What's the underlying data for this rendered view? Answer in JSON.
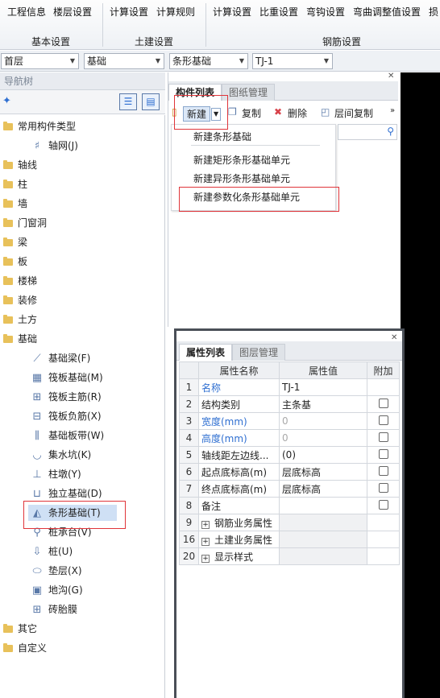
{
  "ribbon": {
    "items": [
      "工程信息",
      "楼层设置",
      "计算设置",
      "计算规则",
      "计算设置",
      "比重设置",
      "弯钩设置",
      "弯曲调整值设置",
      "损"
    ],
    "groups": [
      "基本设置",
      "土建设置",
      "钢筋设置"
    ]
  },
  "selectors": [
    "首层",
    "基础",
    "条形基础",
    "TJ-1"
  ],
  "nav": {
    "title": "导航树",
    "tree": [
      {
        "label": "常用构件类型",
        "type": "folder"
      },
      {
        "label": "轴网(J)",
        "type": "child",
        "icon": "grid-icon"
      },
      {
        "label": "轴线",
        "type": "folder"
      },
      {
        "label": "柱",
        "type": "folder"
      },
      {
        "label": "墙",
        "type": "folder"
      },
      {
        "label": "门窗洞",
        "type": "folder"
      },
      {
        "label": "梁",
        "type": "folder"
      },
      {
        "label": "板",
        "type": "folder"
      },
      {
        "label": "楼梯",
        "type": "folder"
      },
      {
        "label": "装修",
        "type": "folder"
      },
      {
        "label": "土方",
        "type": "folder"
      },
      {
        "label": "基础",
        "type": "folder"
      },
      {
        "label": "基础梁(F)",
        "type": "child",
        "icon": "foundation-beam-icon"
      },
      {
        "label": "筏板基础(M)",
        "type": "child",
        "icon": "raft-icon"
      },
      {
        "label": "筏板主筋(R)",
        "type": "child",
        "icon": "raft-main-rebar-icon"
      },
      {
        "label": "筏板负筋(X)",
        "type": "child",
        "icon": "raft-neg-rebar-icon"
      },
      {
        "label": "基础板带(W)",
        "type": "child",
        "icon": "slab-strip-icon"
      },
      {
        "label": "集水坑(K)",
        "type": "child",
        "icon": "sump-icon"
      },
      {
        "label": "柱墩(Y)",
        "type": "child",
        "icon": "column-pier-icon"
      },
      {
        "label": "独立基础(D)",
        "type": "child",
        "icon": "isolated-footing-icon"
      },
      {
        "label": "条形基础(T)",
        "type": "child",
        "icon": "strip-footing-icon"
      },
      {
        "label": "桩承台(V)",
        "type": "child",
        "icon": "pile-cap-icon"
      },
      {
        "label": "桩(U)",
        "type": "child",
        "icon": "pile-icon"
      },
      {
        "label": "垫层(X)",
        "type": "child",
        "icon": "cushion-icon"
      },
      {
        "label": "地沟(G)",
        "type": "child",
        "icon": "trench-icon"
      },
      {
        "label": "砖胎膜",
        "type": "child",
        "icon": "brick-mold-icon"
      },
      {
        "label": "其它",
        "type": "folder"
      },
      {
        "label": "自定义",
        "type": "folder"
      }
    ]
  },
  "components": {
    "tabs": [
      "构件列表",
      "图纸管理"
    ],
    "toolbar": {
      "new": "新建",
      "copy": "复制",
      "delete": "删除",
      "floor_copy": "层间复制"
    },
    "menu": [
      "新建条形基础",
      "新建矩形条形基础单元",
      "新建异形条形基础单元",
      "新建参数化条形基础单元"
    ]
  },
  "properties": {
    "tabs": [
      "属性列表",
      "图层管理"
    ],
    "headers": [
      "属性名称",
      "属性值",
      "附加"
    ],
    "rows": [
      {
        "num": "1",
        "name": "名称",
        "value": "TJ-1",
        "name_blue": true,
        "check": false
      },
      {
        "num": "2",
        "name": "结构类别",
        "value": "主条基",
        "check": true
      },
      {
        "num": "3",
        "name": "宽度(mm)",
        "value": "0",
        "name_blue": true,
        "value_gray": true,
        "check": true
      },
      {
        "num": "4",
        "name": "高度(mm)",
        "value": "0",
        "name_blue": true,
        "value_gray": true,
        "check": true
      },
      {
        "num": "5",
        "name": "轴线距左边线...",
        "value": "(0)",
        "check": true
      },
      {
        "num": "6",
        "name": "起点底标高(m)",
        "value": "层底标高",
        "check": true
      },
      {
        "num": "7",
        "name": "终点底标高(m)",
        "value": "层底标高",
        "check": true
      },
      {
        "num": "8",
        "name": "备注",
        "value": "",
        "check": true
      },
      {
        "num": "9",
        "name": "钢筋业务属性",
        "value": "",
        "group": true
      },
      {
        "num": "16",
        "name": "土建业务属性",
        "value": "",
        "group": true
      },
      {
        "num": "20",
        "name": "显示样式",
        "value": "",
        "group": true
      }
    ]
  }
}
